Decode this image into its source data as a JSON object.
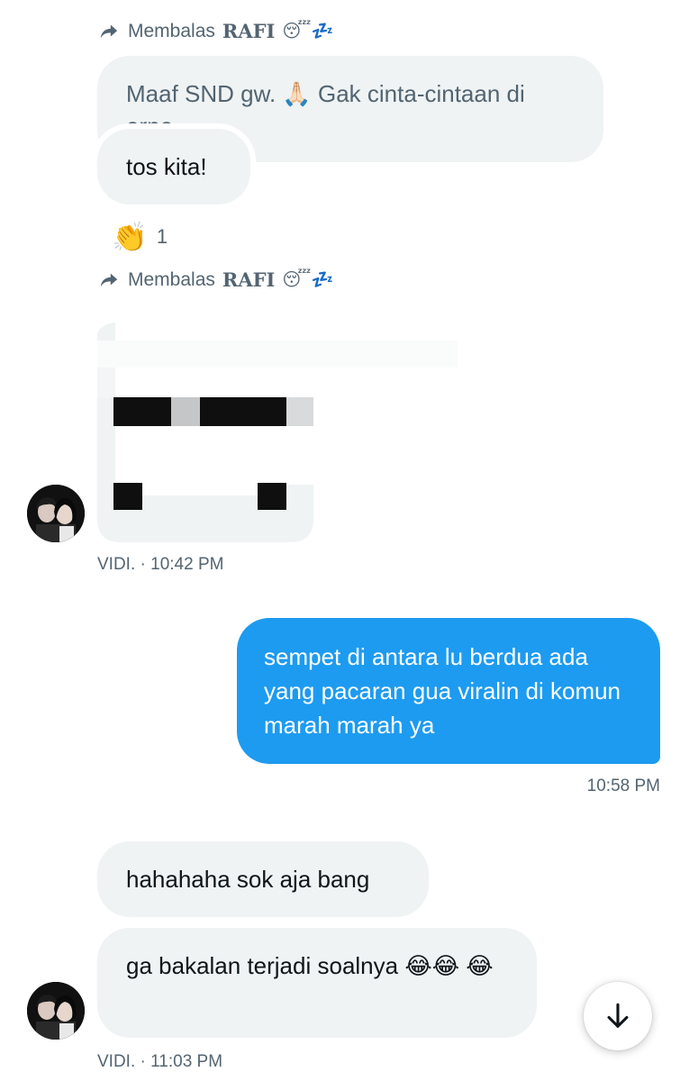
{
  "messages": [
    {
      "reply_to": {
        "prefix": "Membalas",
        "name": "RAFI",
        "emoji": "😴💤"
      },
      "quoted_text": "Maaf SND gw. 🙏🏻 Gak cinta-cintaan di erpe.",
      "text": "tos kita!",
      "reaction": {
        "emoji": "👏",
        "count": "1"
      }
    },
    {
      "reply_to": {
        "prefix": "Membalas",
        "name": "RAFI",
        "emoji": "😴💤"
      },
      "media": "redacted-image",
      "sender": "VIDI.",
      "time": "· 10:42 PM"
    },
    {
      "outgoing_text": "sempet di antara lu berdua ada yang pacaran gua viralin di komun marah marah ya",
      "time": "10:58 PM"
    },
    {
      "text_1": "hahahaha sok aja bang",
      "text_2": "ga bakalan terjadi soalnya 😂😂 😂",
      "sender": "VIDI.",
      "time": "· 11:03 PM"
    }
  ],
  "icons": {
    "reply": "reply-arrow-icon",
    "scroll_down": "arrow-down-icon"
  },
  "colors": {
    "accent": "#1d9bf0",
    "bubble_bg": "#eff3f4",
    "meta_text": "#536471"
  }
}
